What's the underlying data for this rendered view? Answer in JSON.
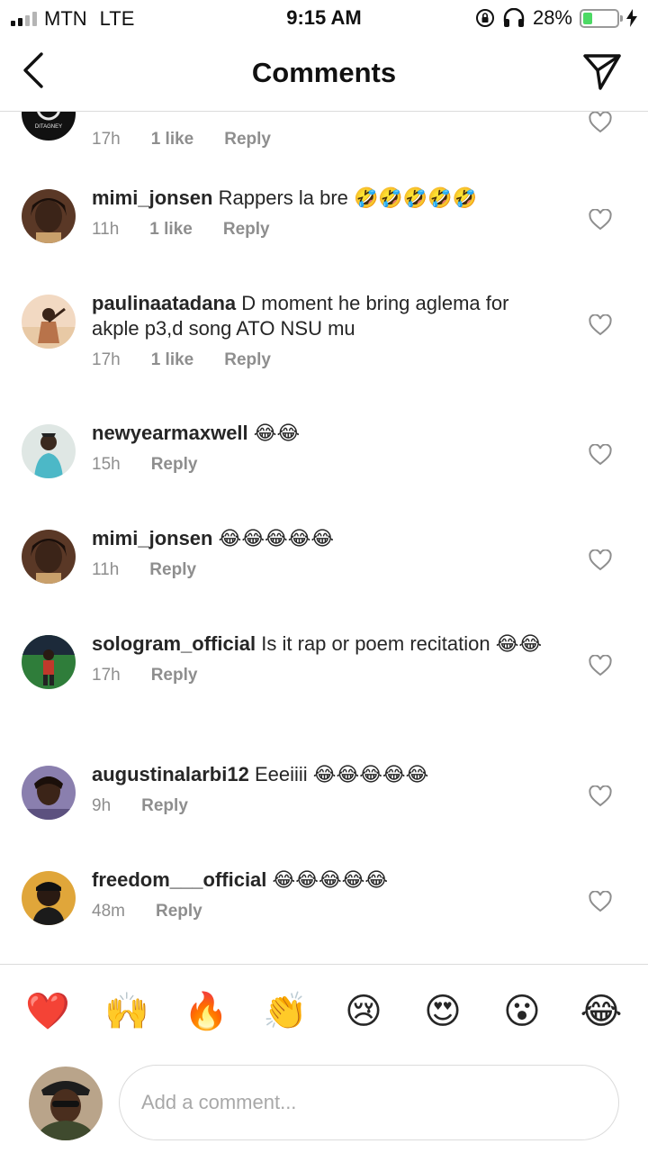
{
  "status_bar": {
    "carrier": "MTN",
    "network": "LTE",
    "time": "9:15 AM",
    "battery_percent": "28%",
    "battery_level": 0.28
  },
  "header": {
    "title": "Comments",
    "back_icon": "chevron-left-icon",
    "share_icon": "paper-plane-icon"
  },
  "top_partial": {
    "time": "17h",
    "likes": "1 like",
    "reply": "Reply",
    "avatar_text": "DITAGNEY"
  },
  "comments": [
    {
      "username": "mimi_jonsen",
      "text": "Rappers la bre 🤣🤣🤣🤣🤣",
      "time": "11h",
      "likes": "1 like",
      "reply": "Reply"
    },
    {
      "username": "paulinaatadana",
      "text": "D moment he bring aglema for akple p3,d song ATO NSU mu",
      "time": "17h",
      "likes": "1 like",
      "reply": "Reply"
    },
    {
      "username": "newyearmaxwell",
      "text": "😂😂",
      "time": "15h",
      "reply": "Reply"
    },
    {
      "username": "mimi_jonsen",
      "text": "😂😂😂😂😂",
      "time": "11h",
      "reply": "Reply"
    },
    {
      "username": "sologram_official",
      "text": "Is it rap or poem recitation 😂😂",
      "time": "17h",
      "reply": "Reply"
    },
    {
      "username": "augustinalarbi12",
      "text": "Eeeiiii 😂😂😂😂😂",
      "time": "9h",
      "reply": "Reply"
    },
    {
      "username": "freedom___official",
      "text": "😂😂😂😂😂",
      "time": "48m",
      "reply": "Reply"
    }
  ],
  "reactions": [
    "❤️",
    "🙌",
    "🔥",
    "👏",
    "😢",
    "😍",
    "😮",
    "😂"
  ],
  "composer": {
    "placeholder": "Add a comment..."
  },
  "colors": {
    "text": "#262626",
    "meta": "#8e8e8e",
    "divider": "#dbdbdb",
    "battery": "#4cd964"
  }
}
